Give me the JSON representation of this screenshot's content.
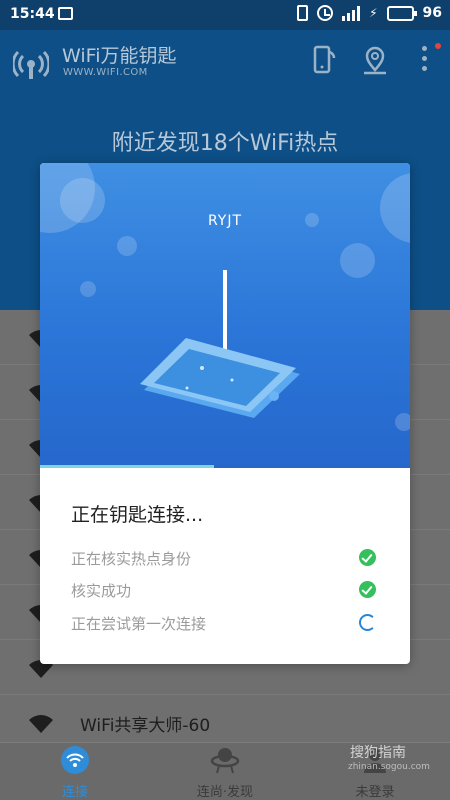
{
  "status_bar": {
    "time": "15:44",
    "battery": "96",
    "colors": {
      "battery": "#36d24a"
    }
  },
  "header": {
    "app_name": "WiFi万能钥匙",
    "app_site": "WWW.WIFI.COM",
    "nearby_text": "附近发现18个WiFi热点",
    "icons": [
      "wifi-key-logo-icon",
      "phone-share-icon",
      "location-pin-icon",
      "more-menu-icon"
    ]
  },
  "list": {
    "items": [
      {
        "name": ""
      },
      {
        "name": ""
      },
      {
        "name": ""
      },
      {
        "name": ""
      },
      {
        "name": ""
      },
      {
        "name": ""
      },
      {
        "name": ""
      },
      {
        "name": "WiFi共享大师-60"
      }
    ]
  },
  "dialog": {
    "ssid": "RYJT",
    "progress": 0.47,
    "title": "正在钥匙连接...",
    "steps": [
      {
        "text": "正在核实热点身份",
        "status": "done",
        "icon": "check-icon"
      },
      {
        "text": "核实成功",
        "status": "done",
        "icon": "check-icon"
      },
      {
        "text": "正在尝试第一次连接",
        "status": "loading",
        "icon": "spinner-icon"
      }
    ],
    "colors": {
      "hero": "#2b76d8",
      "check": "#35c05d",
      "progress": "#7ad8dc"
    }
  },
  "bottom_nav": {
    "items": [
      {
        "label": "连接",
        "active": true
      },
      {
        "label": "连尚·发现",
        "active": false
      },
      {
        "label": "未登录",
        "active": false
      }
    ],
    "active_color": "#2f8cd8"
  },
  "watermark": {
    "brand": "搜狗指南",
    "url": "zhinan.sogou.com"
  }
}
